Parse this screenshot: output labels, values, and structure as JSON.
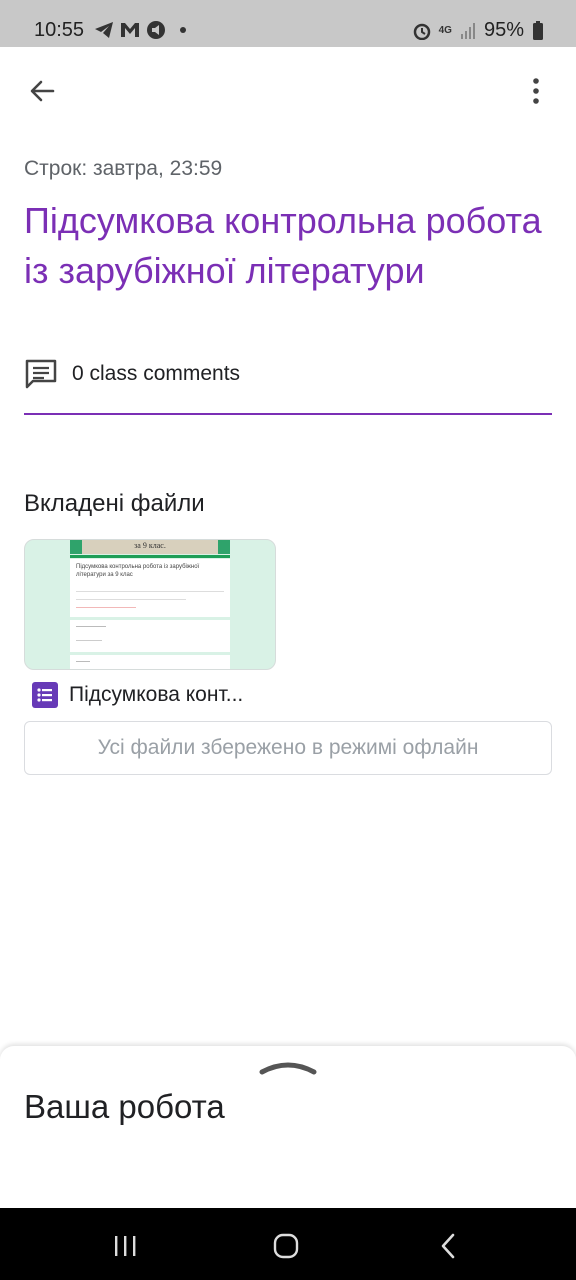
{
  "status_bar": {
    "time": "10:55",
    "battery": "95%",
    "network": "4G"
  },
  "assignment": {
    "due": "Строк: завтра, 23:59",
    "title": "Підсумкова контрольна робота із зарубіжної літератури",
    "comments": "0 class comments",
    "accent_color": "#7b2fb5"
  },
  "attachments": {
    "heading": "Вкладені файли",
    "file_name": "Підсумкова конт...",
    "file_icon": "forms-icon",
    "offline_notice": "Усі файли збережено в режимі офлайн",
    "preview": {
      "header": "за 9 клас.",
      "form_title": "Підсумкова контрольна робота із зарубіжної літератури за 9 клас"
    }
  },
  "your_work": {
    "title": "Ваша робота"
  },
  "icons": {
    "back": "arrow-back-icon",
    "more": "more-vert-icon",
    "comments": "comment-icon",
    "nav_recent": "recent-apps-icon",
    "nav_home": "home-icon",
    "nav_back": "nav-back-icon"
  }
}
